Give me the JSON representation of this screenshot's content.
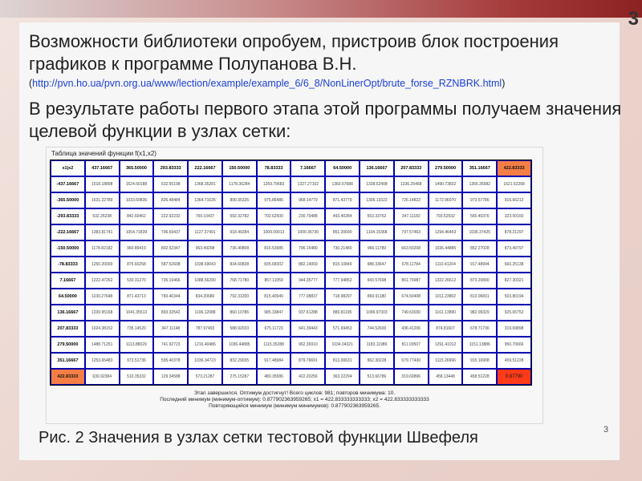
{
  "slide": {
    "number": "3",
    "corner_number": "3",
    "heading": "Возможности библиотеки опробуем, пристроив блок построения графиков к программе Полупанова В.Н.",
    "link_open": "(",
    "link_url": "http://pvn.ho.ua/pvn.org.ua/www/lection/example/example_6/6_8/NonLinerOpt/brute_forse_RZNBRK.html",
    "link_close": ")",
    "subheading": "В результате работы первого этапа этой программы получаем значения целевой функции в узлах сетки:",
    "caption": "Рис. 2 Значения в узлах сетки тестовой функции Швефеля"
  },
  "screenshot": {
    "title": "Таблица значений функции f(x1,x2)",
    "corner": "x1|x2",
    "col_headers": [
      "437.16667",
      "365.50000",
      "293.83333",
      "222.16667",
      "150.50000",
      "78.83333",
      "7.16667",
      "64.50000",
      "136.16667",
      "207.83333",
      "279.50000",
      "351.16667",
      "422.83333"
    ],
    "rows": [
      {
        "h": "-437.16667",
        "v": [
          "1518.18898",
          "1524.50188",
          "632.55198",
          "1368.35281",
          "1178.36284",
          "1269.79683",
          "1327.27102",
          "1360.57688",
          "1338.52408",
          "1336.25468",
          "1490.73832",
          "1356.35982",
          "1621.52268"
        ]
      },
      {
        "h": "-365.50000",
        "v": [
          "1631.22789",
          "1033.69836",
          "826.48484",
          "1364.71635",
          "890.35326",
          "975.86486",
          "968.14779",
          "871.43779",
          "1306.13322",
          "726.14822",
          "1172.96070",
          "973.57786",
          "916.66212"
        ]
      },
      {
        "h": "-293.83333",
        "v": [
          "532.26238",
          "842.60462",
          "222.92232",
          "769.10437",
          "592.32782",
          "702.62500",
          "230.70488",
          "493.40284",
          "553.33762",
          "347.11182",
          "793.52532",
          "565.40376",
          "323.00160"
        ]
      },
      {
        "h": "-222.16667",
        "v": [
          "1383.81741",
          "1054.71839",
          "706.69437",
          "1127.37491",
          "918.49284",
          "1009.09013",
          "1000.36730",
          "851.20690",
          "1104.15368",
          "797.57463",
          "1294.46453",
          "1036.37425",
          "878.21297"
        ]
      },
      {
        "h": "-150.50000",
        "v": [
          "1178.82182",
          "960.89419",
          "802.52347",
          "963.49208",
          "736.40808",
          "816.53985",
          "796.15480",
          "730.21480",
          "966.11789",
          "663.50208",
          "1036.44885",
          "852.27028",
          "873.49797"
        ]
      },
      {
        "h": "-78.83333",
        "v": [
          "1250.20000",
          "875.60258",
          "587.52608",
          "1038.69043",
          "834.60838",
          "835.68302",
          "882.14069",
          "815.10849",
          "988.33647",
          "678.11784",
          "1110.41204",
          "917.48994",
          "660.25138"
        ]
      },
      {
        "h": "7.16667",
        "v": [
          "1222.47262",
          "530.31270",
          "735.19466",
          "1088.56290",
          "768.71780",
          "857.11059",
          "944.35777",
          "777.94852",
          "943.57698",
          "861.79987",
          "1322.26612",
          "873.20890",
          "827.30321"
        ]
      },
      {
        "h": "64.50000",
        "v": [
          "1100.27648",
          "871.43713",
          "783.40344",
          "834.20680",
          "792.31200",
          "815.40949",
          "777.08837",
          "718.98297",
          "869.91180",
          "674.50408",
          "1011.23802",
          "813.06831",
          "503.80194"
        ]
      },
      {
        "h": "136.16667",
        "v": [
          "1339.95168",
          "1041.35513",
          "893.32542",
          "1106.12088",
          "860.10786",
          "985.33847",
          "937.61288",
          "880.81195",
          "1096.97303",
          "749.63030",
          "1161.13890",
          "982.09329",
          "925.65752"
        ]
      },
      {
        "h": "207.83333",
        "v": [
          "1024.38152",
          "735.14520",
          "347.11148",
          "787.97493",
          "588.92033",
          "675.11723",
          "641.39443",
          "571.69453",
          "744.52600",
          "436.41206",
          "874.81607",
          "678.71736",
          "319.69898"
        ]
      },
      {
        "h": "279.50000",
        "v": [
          "1488.71251",
          "1113.88029",
          "741.92723",
          "1216.40486",
          "1036.44885",
          "1115.35288",
          "962.36910",
          "1034.04321",
          "1183.11989",
          "811.03507",
          "1291.41012",
          "1151.13886",
          "950.70666"
        ]
      },
      {
        "h": "351.16667",
        "v": [
          "1253.65483",
          "973.51736",
          "595.40378",
          "1036.34723",
          "832.29035",
          "917.48984",
          "879.76691",
          "813.00631",
          "962.30228",
          "679.77430",
          "1115.26996",
          "915.16908",
          "459.51228"
        ]
      },
      {
        "h": "422.83333",
        "v": [
          "630.92384",
          "510.35332",
          "129.34588",
          "573.21287",
          "275.15287",
          "480.35586",
          "422.20256",
          "363.22294",
          "513.66786",
          "319.69896",
          "458.13448",
          "458.51228",
          "0.87790"
        ]
      }
    ],
    "status_lines": [
      "Этап завершился. Оптимум достигнут! Всего циклов: 981; повторов минимума: 10.",
      "Последний минимум (минимум-оптимум): 0.877902363959265; x1 = 422.833333333333; x2 = 422.833333333333",
      "Повторяющийся минимум (минимум минимумов): 0.877902363959265."
    ]
  }
}
